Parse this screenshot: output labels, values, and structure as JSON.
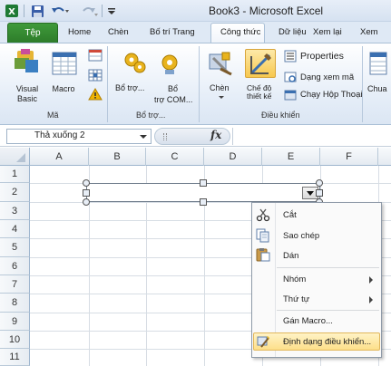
{
  "window": {
    "title": "Book3 - Microsoft Excel",
    "app_icon": "excel-icon",
    "quick_access": [
      "save-icon",
      "undo-icon",
      "redo-icon",
      "customize-qat-icon"
    ]
  },
  "tabs": [
    {
      "label": "Tệp"
    },
    {
      "label": "Home"
    },
    {
      "label": "Chèn"
    },
    {
      "label": "Bố trí Trang"
    },
    {
      "label": "Công thức"
    },
    {
      "label": "Dữ liệu"
    },
    {
      "label": "Xem lại"
    },
    {
      "label": "Xem"
    }
  ],
  "ribbon": {
    "code_group": {
      "name": "Mã",
      "visual_basic": "Visual\nBasic",
      "macro": "Macro"
    },
    "addins_group": {
      "name": "Bổ trợ...",
      "addins": "Bổ trợ...",
      "com_addins_line1": "Bổ",
      "com_addins_line2": "trợ COM..."
    },
    "controls_group": {
      "name": "Điều khiển",
      "insert": "Chèn",
      "design_mode_line1": "Chế độ",
      "design_mode_line2": "thiết kế",
      "properties": "Properties",
      "view_code": "Dạng xem mã",
      "run_dialog": "Chạy Hộp Thoại"
    },
    "xml_partial": "Chua"
  },
  "formula_bar": {
    "name_box": "Thả xuống 2",
    "fx": "fx",
    "value": ""
  },
  "grid": {
    "columns": [
      "A",
      "B",
      "C",
      "D",
      "E",
      "F"
    ],
    "rows": [
      "1",
      "2",
      "3",
      "4",
      "5",
      "6",
      "7",
      "8",
      "9",
      "10",
      "11"
    ]
  },
  "context_menu": {
    "items": [
      {
        "label": "Cắt",
        "icon": "scissors-icon"
      },
      {
        "label": "Sao chép",
        "icon": "copy-icon"
      },
      {
        "label": "Dán",
        "icon": "paste-icon"
      },
      {
        "label": "Nhóm",
        "submenu": true
      },
      {
        "label": "Thứ tự",
        "submenu": true
      },
      {
        "label": "Gán Macro..."
      },
      {
        "label": "Định dạng điều khiển...",
        "icon": "format-control-icon",
        "highlighted": true
      }
    ]
  }
}
